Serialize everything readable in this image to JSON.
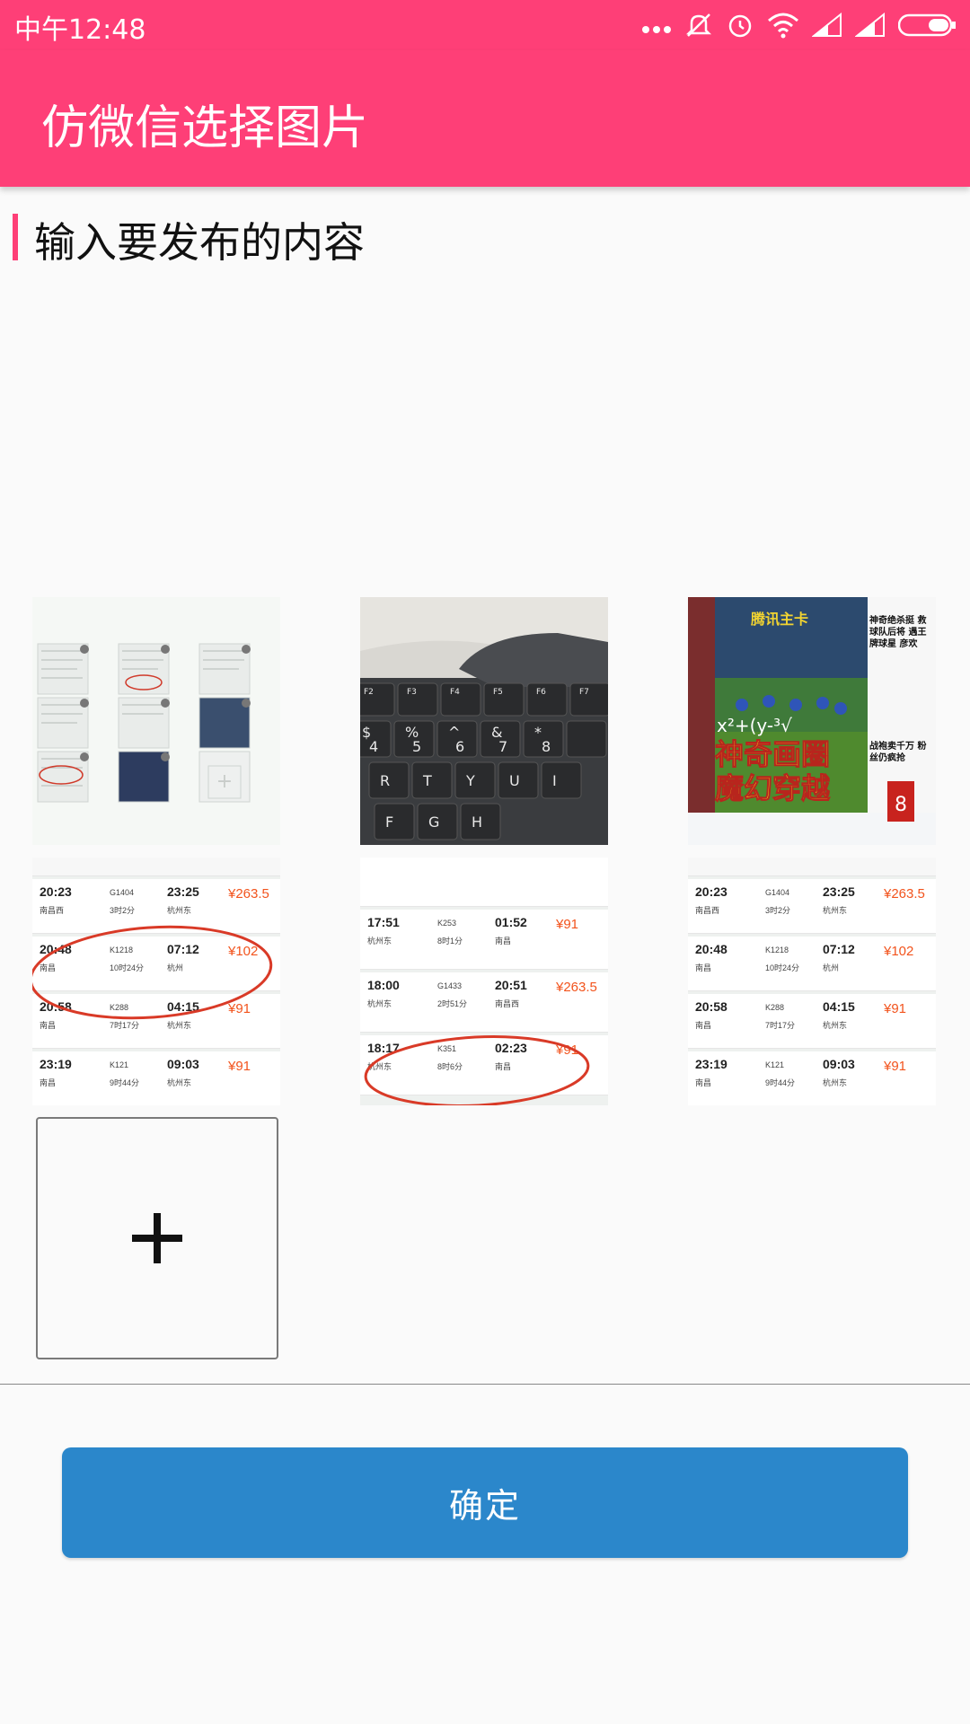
{
  "status_bar": {
    "time": "中午12:48"
  },
  "app_bar": {
    "title": "仿微信选择图片"
  },
  "input": {
    "placeholder": "输入要发布的内容"
  },
  "confirm_button": {
    "label": "确定"
  },
  "thumb_keyboard": {
    "keys": [
      "F2",
      "F3",
      "F4",
      "F5",
      "F6",
      "F7",
      "$",
      "%",
      "^",
      "&",
      "*",
      "4",
      "5",
      "6",
      "7",
      "8",
      "R",
      "T",
      "Y",
      "U",
      "I",
      "F",
      "G",
      "H"
    ]
  },
  "thumb_football": {
    "headline_line1": "神奇画圈",
    "headline_line2": "魔幻穿越",
    "side_text": "神奇绝杀挺 救球队后将 遇王牌球星 彦欢",
    "bottom_side": "战袍卖千万 粉丝仍疯抢",
    "formula": "x²+(y-³√",
    "brand": "腾讯主卡",
    "number": "8"
  },
  "train_rows_a": [
    {
      "dep": "20:23",
      "train": "G1404",
      "arr": "23:25",
      "from": "南昌西",
      "dur": "3时2分",
      "to": "杭州东",
      "price": "¥263.5"
    },
    {
      "dep": "20:48",
      "train": "K1218",
      "arr": "07:12",
      "from": "南昌",
      "dur": "10时24分",
      "to": "杭州",
      "price": "¥102"
    },
    {
      "dep": "20:58",
      "train": "K288",
      "arr": "04:15",
      "from": "南昌",
      "dur": "7时17分",
      "to": "杭州东",
      "price": "¥91"
    },
    {
      "dep": "23:19",
      "train": "K121",
      "arr": "09:03",
      "from": "南昌",
      "dur": "9时44分",
      "to": "杭州东",
      "price": "¥91"
    }
  ],
  "train_rows_b": [
    {
      "dep": "17:51",
      "train": "K253",
      "arr": "01:52",
      "from": "杭州东",
      "dur": "8时1分",
      "to": "南昌",
      "price": "¥91"
    },
    {
      "dep": "18:00",
      "train": "G1433",
      "arr": "20:51",
      "from": "杭州东",
      "dur": "2时51分",
      "to": "南昌西",
      "price": "¥263.5"
    },
    {
      "dep": "18:17",
      "train": "K351",
      "arr": "02:23",
      "from": "杭州东",
      "dur": "8时6分",
      "to": "南昌",
      "price": "¥91"
    }
  ]
}
